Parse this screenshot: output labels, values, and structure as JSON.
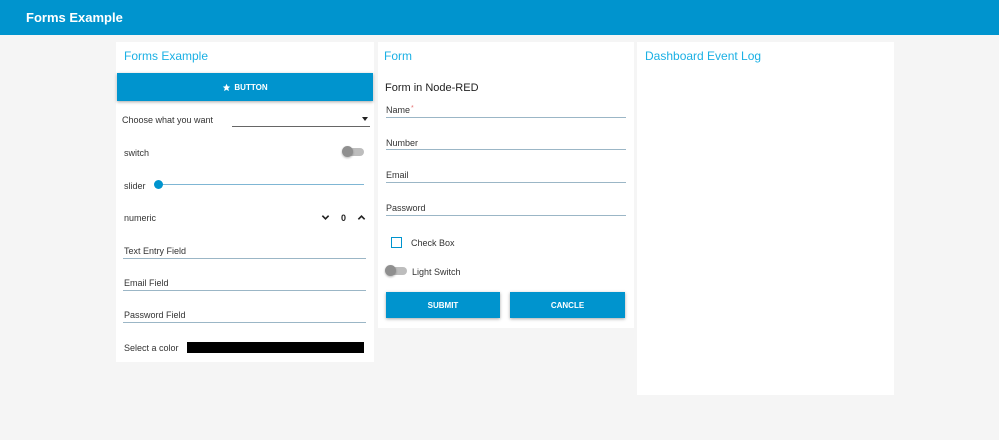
{
  "header": {
    "title": "Forms Example"
  },
  "colors": {
    "accent": "#0094ce",
    "card_title": "#1bb0e4",
    "background": "#f5f5f5"
  },
  "forms_card": {
    "title": "Forms Example",
    "button_label": "BUTTON",
    "button_icon": "star-icon",
    "dropdown_label": "Choose what you want",
    "dropdown_value": "",
    "switch_label": "switch",
    "switch_on": false,
    "slider_label": "slider",
    "slider_value_fraction": 0,
    "numeric_label": "numeric",
    "numeric_value": "0",
    "text_entry_placeholder": "Text Entry Field",
    "email_placeholder": "Email Field",
    "password_placeholder": "Password Field",
    "color_label": "Select a color",
    "color_value": "#000000"
  },
  "form_card": {
    "title": "Form",
    "form_title": "Form in Node-RED",
    "name_label": "Name",
    "name_required_mark": "*",
    "number_label": "Number",
    "email_label": "Email",
    "password_label": "Password",
    "checkbox_label": "Check Box",
    "checkbox_checked": false,
    "light_switch_label": "Light Switch",
    "light_switch_on": false,
    "submit_label": "SUBMIT",
    "cancel_label": "CANCLE"
  },
  "event_log_card": {
    "title": "Dashboard Event Log"
  }
}
